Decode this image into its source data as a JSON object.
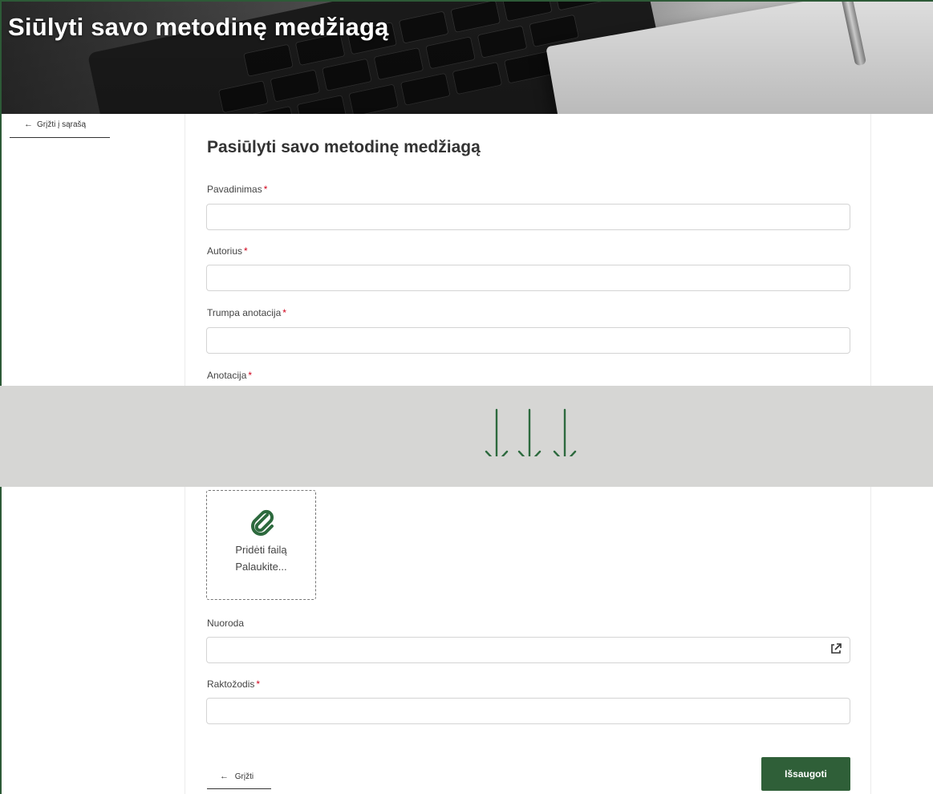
{
  "banner": {
    "title": "Siūlyti savo metodinę medžiagą"
  },
  "nav": {
    "back_top_label": "Grįžti į sąrašą",
    "back_bottom_label": "Grįžti"
  },
  "form": {
    "title": "Pasiūlyti savo metodinę medžiagą",
    "required_mark": "*",
    "fields": {
      "pavadinimas": {
        "label": "Pavadinimas",
        "value": "",
        "required": true
      },
      "autorius": {
        "label": "Autorius",
        "value": "",
        "required": true
      },
      "trumpa_anotacija": {
        "label": "Trumpa anotacija",
        "value": "",
        "required": true
      },
      "anotacija": {
        "label": "Anotacija",
        "required": true
      },
      "nuoroda": {
        "label": "Nuoroda",
        "value": "",
        "required": false
      },
      "raktazodis": {
        "label": "Raktožodis",
        "value": "",
        "required": true
      }
    },
    "file_upload": {
      "add_label": "Pridėti failą",
      "status": "Palaukite..."
    },
    "save_label": "Išsaugoti"
  },
  "colors": {
    "brand_green": "#2f5f38",
    "arrow_green": "#2d6a3e",
    "required_red": "#d0021b",
    "band_gray": "#d6d6d4"
  },
  "icons": {
    "back": "arrow-left-icon",
    "attach": "paperclip-icon",
    "external_link": "external-link-icon",
    "scroll_hint": "arrow-down-icon"
  }
}
